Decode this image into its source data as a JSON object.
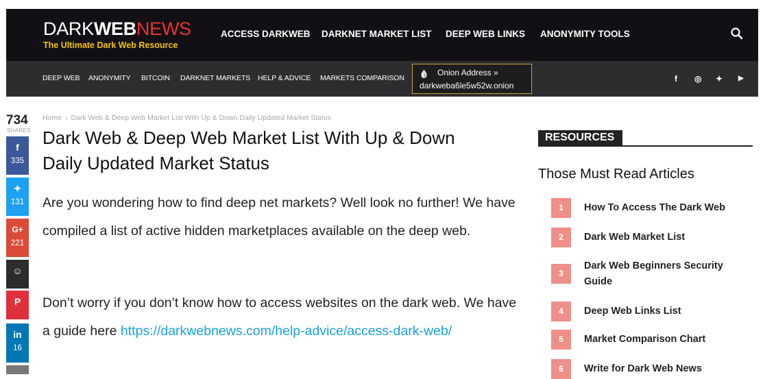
{
  "header": {
    "logo": {
      "dark": "DARK",
      "web": "WEB",
      "news": "NEWS",
      "tagline": "The Ultimate Dark Web Resource"
    },
    "main_nav": [
      "ACCESS DARKWEB",
      "DARKNET MARKET LIST",
      "DEEP WEB LINKS",
      "ANONYMITY TOOLS"
    ],
    "search_icon": "search-icon"
  },
  "subnav": {
    "items": [
      "DEEP WEB",
      "ANONYMITY",
      "BITCOIN",
      "DARKNET MARKETS",
      "HELP & ADVICE",
      "MARKETS COMPARISON"
    ],
    "onion": {
      "label": "Onion Address »",
      "address": "darkweba6le5w52w.onion",
      "icon": "onion-icon"
    },
    "social": [
      {
        "icon": "facebook-icon",
        "glyph": "f"
      },
      {
        "icon": "instagram-icon",
        "glyph": "◎"
      },
      {
        "icon": "twitter-icon",
        "glyph": "✦"
      },
      {
        "icon": "youtube-icon",
        "glyph": "▶"
      }
    ]
  },
  "share": {
    "total": "734",
    "label": "SHARES",
    "buttons": [
      {
        "name": "facebook",
        "glyph": "f",
        "count": "335",
        "color": "#3b5998"
      },
      {
        "name": "twitter",
        "glyph": "✦",
        "count": "131",
        "color": "#1da1f2"
      },
      {
        "name": "google-plus",
        "glyph": "G+",
        "count": "221",
        "color": "#dc4a38"
      },
      {
        "name": "reddit",
        "glyph": "☺",
        "count": "",
        "color": "#2c2c2c"
      },
      {
        "name": "pinterest",
        "glyph": "P",
        "count": "",
        "color": "#e0303b"
      },
      {
        "name": "linkedin",
        "glyph": "in",
        "count": "16",
        "color": "#0077b5"
      }
    ]
  },
  "article": {
    "breadcrumb": {
      "home": "Home",
      "sep": "›",
      "current": "Dark Web & Deep Web Market List With Up & Down Daily Updated Market Status"
    },
    "title_line1": "Dark Web & Deep Web Market List With Up & Down",
    "title_line2": "Daily Updated Market Status",
    "para1": "Are you wondering how to find deep net markets? Well look no further! We have compiled a list of active hidden marketplaces available on the deep web.",
    "para2_text": "Don’t worry if you don’t know how to access websites on the dark web. We have a guide here ",
    "para2_link": "https://darkwebnews.com/help-advice/access-dark-web/"
  },
  "sidebar": {
    "heading": "RESOURCES",
    "subheading": "Those Must Read Articles",
    "articles": [
      {
        "num": "1",
        "title": "How To Access The Dark Web"
      },
      {
        "num": "2",
        "title": "Dark Web Market List"
      },
      {
        "num": "3",
        "title": "Dark Web Beginners Security Guide"
      },
      {
        "num": "4",
        "title": "Deep Web Links List"
      },
      {
        "num": "5",
        "title": "Market Comparison Chart"
      },
      {
        "num": "6",
        "title": "Write for Dark Web News"
      }
    ]
  }
}
